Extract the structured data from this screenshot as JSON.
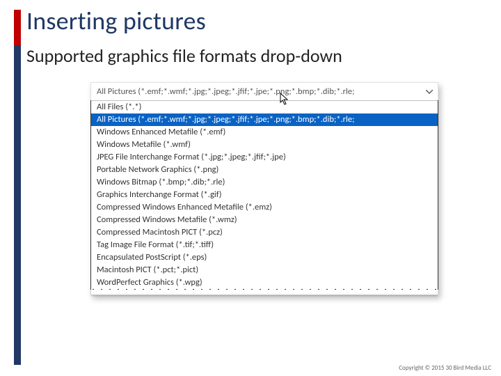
{
  "title": "Inserting pictures",
  "subtitle": "Supported graphics file formats drop-down",
  "dropdown": {
    "header": "All Pictures (*.emf;*.wmf;*.jpg;*.jpeg;*.jfif;*.jpe;*.png;*.bmp;*.dib;*.rle;",
    "selected_index": 1,
    "items": [
      "All Files (*.*)",
      "All Pictures (*.emf;*.wmf;*.jpg;*.jpeg;*.jfif;*.jpe;*.png;*.bmp;*.dib;*.rle;",
      "Windows Enhanced Metafile (*.emf)",
      "Windows Metafile (*.wmf)",
      "JPEG File Interchange Format (*.jpg;*.jpeg;*.jfif;*.jpe)",
      "Portable Network Graphics (*.png)",
      "Windows Bitmap (*.bmp;*.dib;*.rle)",
      "Graphics Interchange Format (*.gif)",
      "Compressed Windows Enhanced Metafile (*.emz)",
      "Compressed Windows Metafile (*.wmz)",
      "Compressed Macintosh PICT (*.pcz)",
      "Tag Image File Format (*.tif;*.tiff)",
      "Encapsulated PostScript (*.eps)",
      "Macintosh PICT (*.pct;*.pict)",
      "WordPerfect Graphics (*.wpg)"
    ]
  },
  "footer": "Copyright © 2015 30 Bird Media LLC"
}
